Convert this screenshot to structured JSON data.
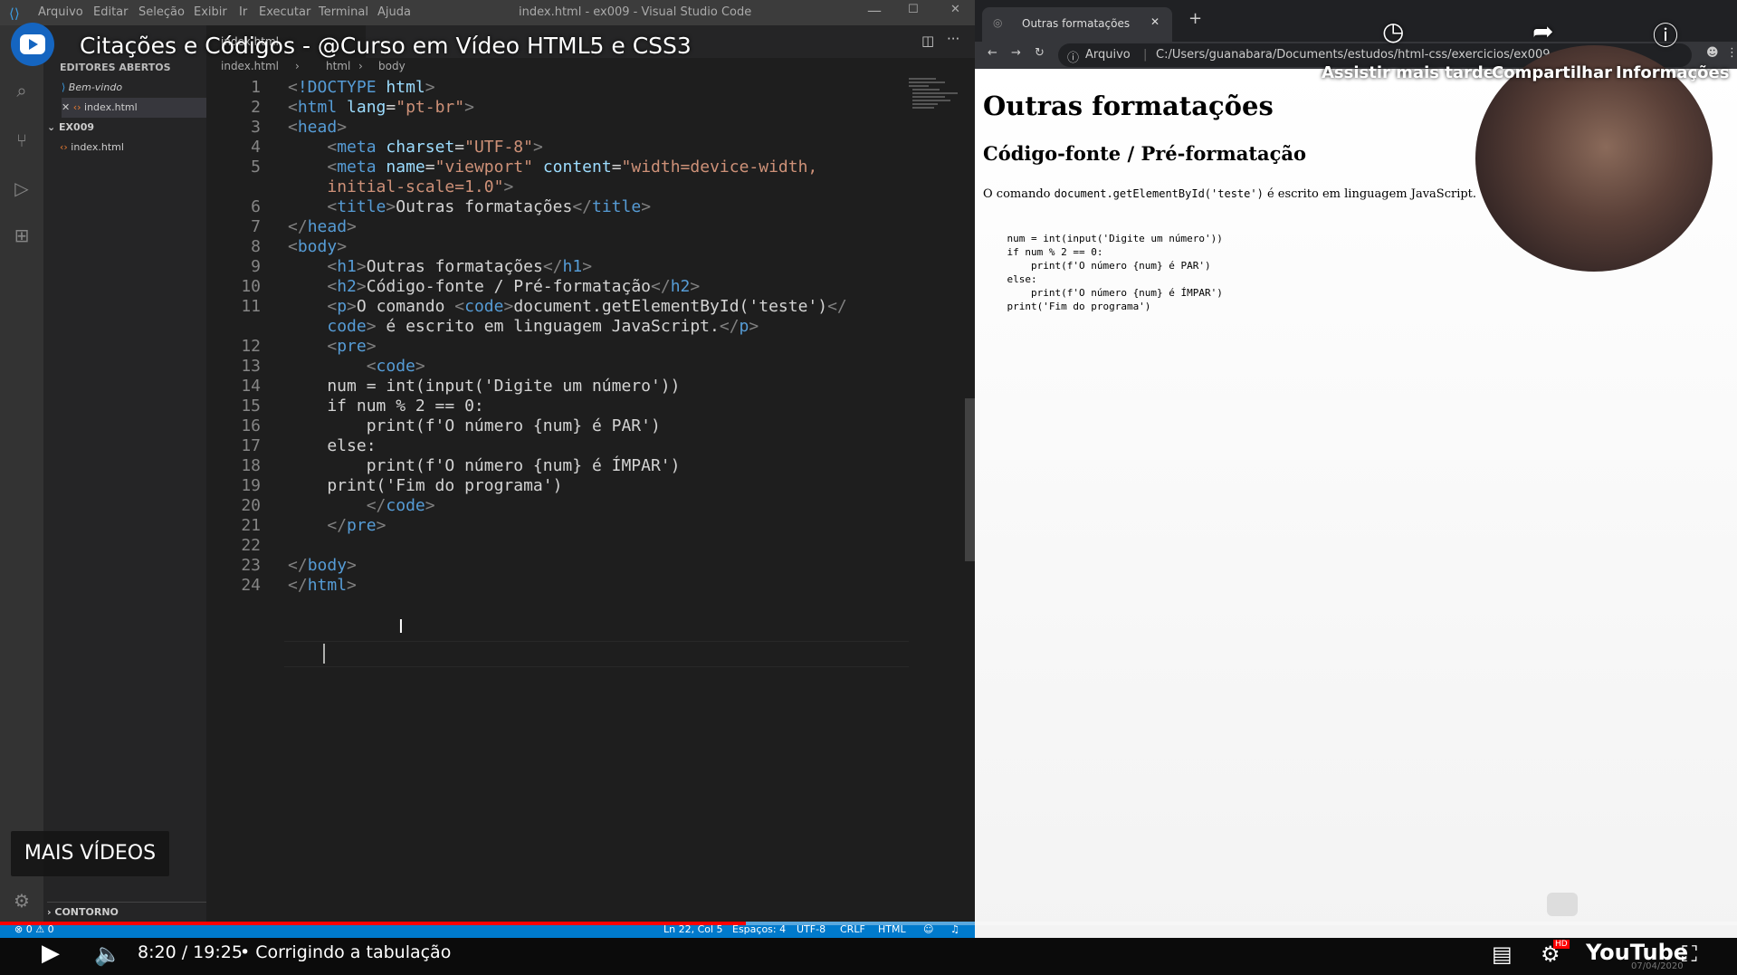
{
  "video": {
    "title": "Citações e Códigos - @Curso em Vídeo HTML5 e CSS3",
    "actions": [
      "Assistir mais tarde",
      "Compartilhar",
      "Informações"
    ],
    "more_videos": "MAIS VÍDEOS",
    "time": "8:20 / 19:25",
    "chapter": "• Corrigindo a tabulação",
    "progress": 0.4296,
    "badge": "HD",
    "brand": "YouTube",
    "taskbar_date": "07/04/2020"
  },
  "vscode": {
    "window_title": "index.html - ex009 - Visual Studio Code",
    "menu": [
      "Arquivo",
      "Editar",
      "Seleção",
      "Exibir",
      "Ir",
      "Executar",
      "Terminal",
      "Ajuda"
    ],
    "explorer": {
      "section_open": "EDITORES ABERTOS",
      "open_files": [
        "Bem-vindo",
        "index.html"
      ],
      "folder": "EX009",
      "files": [
        "index.html"
      ],
      "outline": "CONTORNO"
    },
    "tab": "index.html",
    "breadcrumb": [
      "index.html",
      "html",
      "body"
    ],
    "code_lines": [
      {
        "n": "1",
        "html": "<span class='br'>&lt;</span><span class='tg'>!DOCTYPE</span> <span class='at'>html</span><span class='br'>&gt;</span>"
      },
      {
        "n": "2",
        "html": "<span class='br'>&lt;</span><span class='tg'>html</span> <span class='at'>lang</span>=<span class='st'>\"pt-br\"</span><span class='br'>&gt;</span>"
      },
      {
        "n": "3",
        "html": "<span class='br'>&lt;</span><span class='tg'>head</span><span class='br'>&gt;</span>"
      },
      {
        "n": "4",
        "html": "    <span class='br'>&lt;</span><span class='tg'>meta</span> <span class='at'>charset</span>=<span class='st'>\"UTF-8\"</span><span class='br'>&gt;</span>"
      },
      {
        "n": "5",
        "html": "    <span class='br'>&lt;</span><span class='tg'>meta</span> <span class='at'>name</span>=<span class='st'>\"viewport\"</span> <span class='at'>content</span>=<span class='st'>\"width=device-width,</span>"
      },
      {
        "n": "",
        "html": "    <span class='st'>initial-scale=1.0\"</span><span class='br'>&gt;</span>"
      },
      {
        "n": "6",
        "html": "    <span class='br'>&lt;</span><span class='tg'>title</span><span class='br'>&gt;</span>Outras formatações<span class='br'>&lt;/</span><span class='tg'>title</span><span class='br'>&gt;</span>"
      },
      {
        "n": "7",
        "html": "<span class='br'>&lt;/</span><span class='tg'>head</span><span class='br'>&gt;</span>"
      },
      {
        "n": "8",
        "html": "<span class='br'>&lt;</span><span class='tg'>body</span><span class='br'>&gt;</span>"
      },
      {
        "n": "9",
        "html": "    <span class='br'>&lt;</span><span class='tg'>h1</span><span class='br'>&gt;</span>Outras formatações<span class='br'>&lt;/</span><span class='tg'>h1</span><span class='br'>&gt;</span>"
      },
      {
        "n": "10",
        "html": "    <span class='br'>&lt;</span><span class='tg'>h2</span><span class='br'>&gt;</span>Código-fonte / Pré-formatação<span class='br'>&lt;/</span><span class='tg'>h2</span><span class='br'>&gt;</span>"
      },
      {
        "n": "11",
        "html": "    <span class='br'>&lt;</span><span class='tg'>p</span><span class='br'>&gt;</span>O comando <span class='br'>&lt;</span><span class='tg'>code</span><span class='br'>&gt;</span>document.getElementById('teste')<span class='br'>&lt;/</span>"
      },
      {
        "n": "",
        "html": "    <span class='tg'>code</span><span class='br'>&gt;</span> é escrito em linguagem JavaScript.<span class='br'>&lt;/</span><span class='tg'>p</span><span class='br'>&gt;</span>"
      },
      {
        "n": "12",
        "html": "    <span class='br'>&lt;</span><span class='tg'>pre</span><span class='br'>&gt;</span>"
      },
      {
        "n": "13",
        "html": "        <span class='br'>&lt;</span><span class='tg'>code</span><span class='br'>&gt;</span>"
      },
      {
        "n": "14",
        "html": "    num = int(input('Digite um número'))"
      },
      {
        "n": "15",
        "html": "    if num % 2 == 0:"
      },
      {
        "n": "16",
        "html": "        print(f'O número {num} é PAR')"
      },
      {
        "n": "17",
        "html": "    else:"
      },
      {
        "n": "18",
        "html": "        print(f'O número {num} é ÍMPAR')"
      },
      {
        "n": "19",
        "html": "    print('Fim do programa')"
      },
      {
        "n": "20",
        "html": "        <span class='br'>&lt;/</span><span class='tg'>code</span><span class='br'>&gt;</span>"
      },
      {
        "n": "21",
        "html": "    <span class='br'>&lt;/</span><span class='tg'>pre</span><span class='br'>&gt;</span>"
      },
      {
        "n": "22",
        "html": ""
      },
      {
        "n": "23",
        "html": "<span class='br'>&lt;/</span><span class='tg'>body</span><span class='br'>&gt;</span>"
      },
      {
        "n": "24",
        "html": "<span class='br'>&lt;/</span><span class='tg'>html</span><span class='br'>&gt;</span>"
      }
    ],
    "status": {
      "errors": "⊗ 0 ⚠ 0",
      "position": "Ln 22, Col 5",
      "spaces": "Espaços: 4",
      "encoding": "UTF-8",
      "eol": "CRLF",
      "language": "HTML"
    }
  },
  "browser": {
    "tab_title": "Outras formatações",
    "address_label": "Arquivo",
    "url": "C:/Users/guanabara/Documents/estudos/html-css/exercicios/ex009",
    "page": {
      "h1": "Outras formatações",
      "h2": "Código-fonte / Pré-formatação",
      "p_before": "O comando ",
      "p_code": "document.getElementById('teste')",
      "p_after": " é escrito em linguagem JavaScript.",
      "pre": "    num = int(input('Digite um número'))\n    if num % 2 == 0:\n        print(f'O número {num} é PAR')\n    else:\n        print(f'O número {num} é ÍMPAR')\n    print('Fim do programa')"
    }
  },
  "colors": {
    "vscode_bg": "#1e1e1e",
    "status_blue": "#007acc",
    "progress_red": "#ff0000",
    "tag_blue": "#569cd6",
    "string_orange": "#ce9178",
    "attr_lightblue": "#9cdcfe"
  }
}
